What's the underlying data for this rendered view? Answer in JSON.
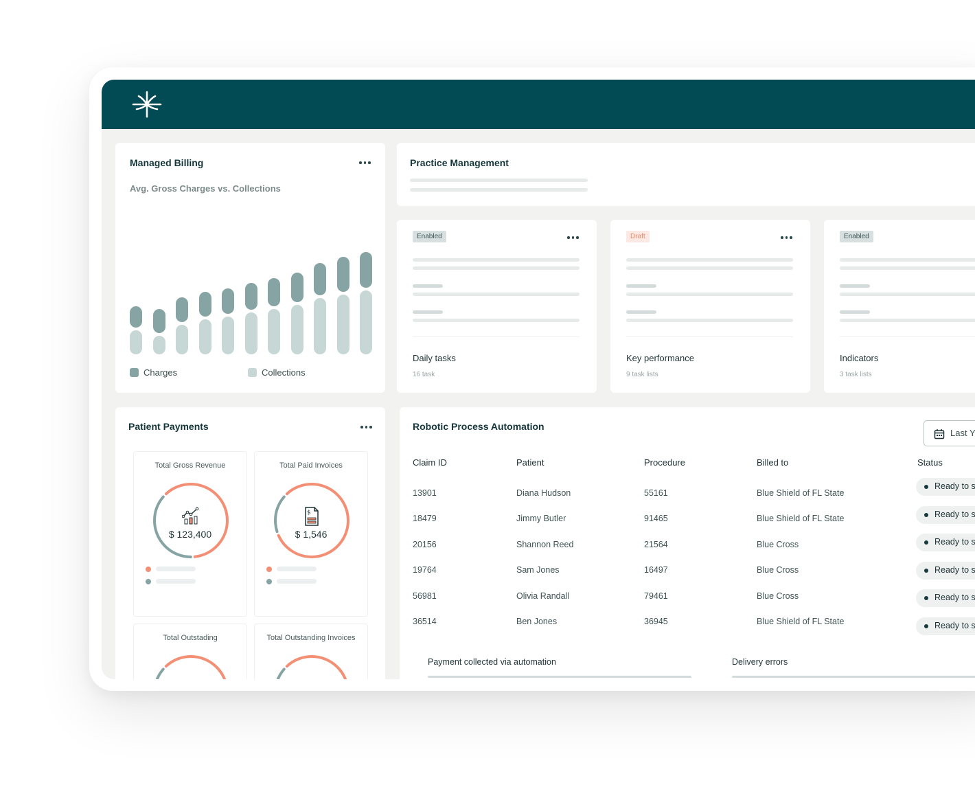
{
  "managed_billing": {
    "title": "Managed Billing",
    "subtitle": "Avg. Gross Charges vs. Collections",
    "legend": {
      "charges": "Charges",
      "collections": "Collections"
    },
    "colors": {
      "charges": "#86a4a3",
      "collections": "#c6d7d5"
    }
  },
  "chart_data": {
    "type": "bar",
    "title": "Avg. Gross Charges vs. Collections",
    "xlabel": "",
    "ylabel": "",
    "series": [
      {
        "name": "Charges",
        "values": [
          37,
          46,
          48,
          48,
          52,
          56,
          60,
          65,
          74,
          82,
          85
        ]
      },
      {
        "name": "Collections",
        "values": [
          35,
          27,
          43,
          51,
          55,
          61,
          66,
          72,
          82,
          87,
          93
        ]
      }
    ],
    "stacked": true,
    "legend_position": "bottom"
  },
  "practice_management": {
    "title": "Practice Management",
    "cards": [
      {
        "badge": "Enabled",
        "badge_type": "enabled",
        "title": "Daily tasks",
        "sub": "16 task"
      },
      {
        "badge": "Draft",
        "badge_type": "draft",
        "title": "Key performance",
        "sub": "9 task lists"
      },
      {
        "badge": "Enabled",
        "badge_type": "enabled",
        "title": "Indicators",
        "sub": "3 task lists"
      }
    ]
  },
  "patient_payments": {
    "title": "Patient Payments",
    "tiles": [
      {
        "title": "Total Gross Revenue",
        "value": "$ 123,400",
        "icon": "chart-growth-icon",
        "orange_fraction": 0.62
      },
      {
        "title": "Total Paid Invoices",
        "value": "$ 1,546",
        "icon": "invoice-icon",
        "orange_fraction": 0.82
      },
      {
        "title": "Total Outstading",
        "value": "",
        "icon": "",
        "orange_fraction": 0.5
      },
      {
        "title": "Total Outstanding Invoices",
        "value": "",
        "icon": "",
        "orange_fraction": 0.5
      }
    ],
    "colors": {
      "orange": "#f28f75",
      "teal": "#86a4a3"
    }
  },
  "rpa": {
    "title": "Robotic Process Automation",
    "date_button": "Last Y",
    "columns": [
      "Claim ID",
      "Patient",
      "Procedure",
      "Billed to",
      "Status"
    ],
    "rows": [
      {
        "claim": "13901",
        "patient": "Diana Hudson",
        "procedure": "55161",
        "billed": "Blue Shield of FL State",
        "status": "Ready to s"
      },
      {
        "claim": "18479",
        "patient": "Jimmy Butler",
        "procedure": "91465",
        "billed": "Blue Shield of FL State",
        "status": "Ready to s"
      },
      {
        "claim": "20156",
        "patient": "Shannon Reed",
        "procedure": "21564",
        "billed": "Blue Cross",
        "status": "Ready to s"
      },
      {
        "claim": "19764",
        "patient": "Sam Jones",
        "procedure": "16497",
        "billed": "Blue Cross",
        "status": "Ready to s"
      },
      {
        "claim": "56981",
        "patient": "Olivia Randall",
        "procedure": "79461",
        "billed": "Blue Cross",
        "status": "Ready to s"
      },
      {
        "claim": "36514",
        "patient": "Ben Jones",
        "procedure": "36945",
        "billed": "Blue Shield of FL State",
        "status": "Ready to s"
      }
    ],
    "footer": {
      "payment": "Payment collected via automation",
      "errors": "Delivery errors"
    }
  },
  "theme": {
    "header": "#024b54",
    "background": "#f2f2f0"
  }
}
